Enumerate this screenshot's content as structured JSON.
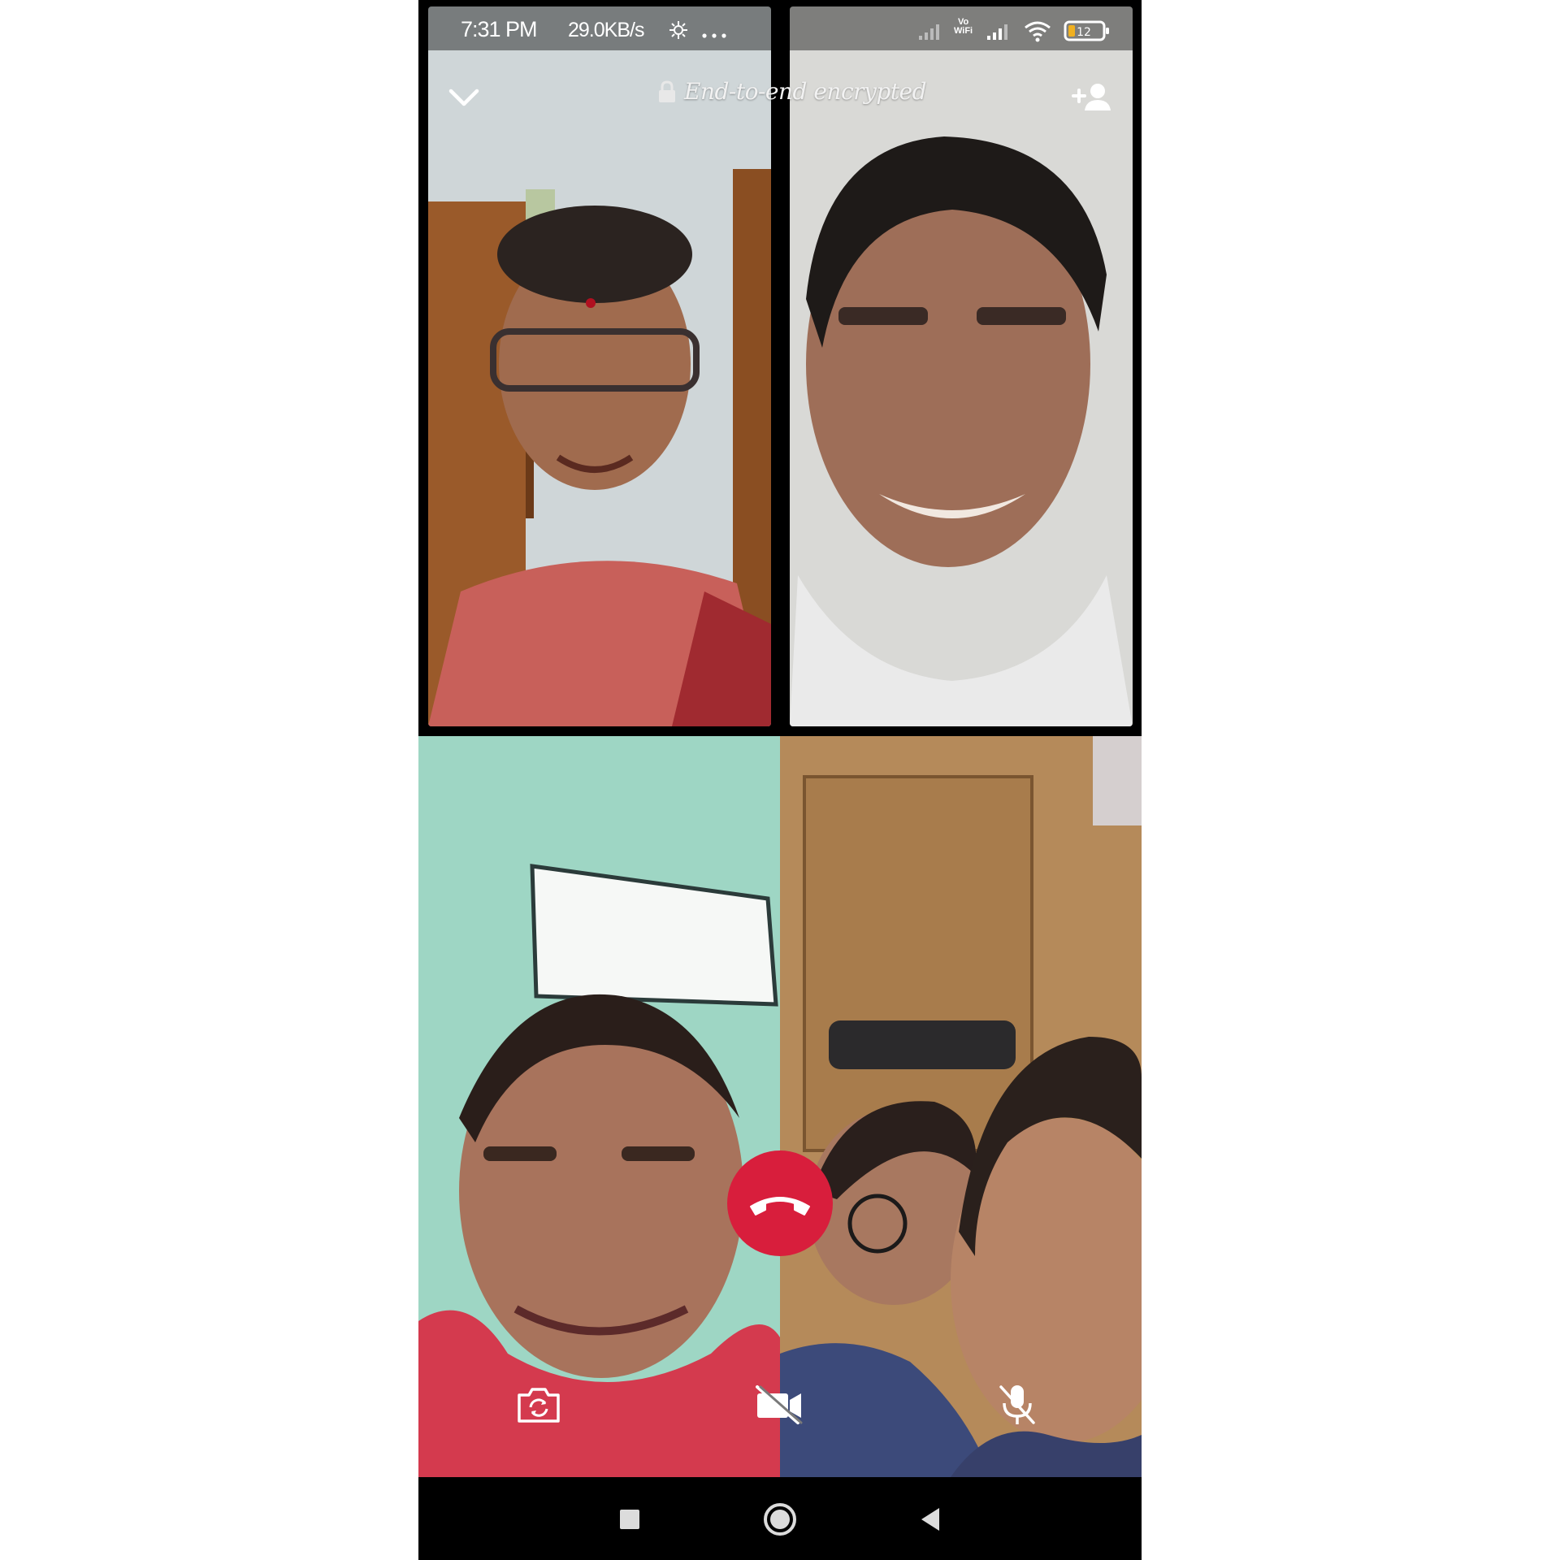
{
  "status_bar": {
    "time": "7:31 PM",
    "network_speed": "29.0KB/s",
    "battery_level": "12",
    "icons": [
      "data-saver-icon",
      "more-notifications-icon",
      "signal-icon",
      "vowifi-icon",
      "signal-icon",
      "wifi-icon",
      "battery-icon"
    ],
    "vowifi_label": "Vo WiFi"
  },
  "call": {
    "encryption_label": "End-to-end encrypted",
    "participants_count": 4,
    "end_call_color": "#d81e3c"
  },
  "controls": {
    "icons": [
      "chevron-down-icon",
      "lock-icon",
      "add-person-icon",
      "end-call-icon",
      "flip-camera-icon",
      "video-off-icon",
      "mic-off-icon"
    ]
  },
  "nav_bar": {
    "icons": [
      "recents-square-icon",
      "home-circle-icon",
      "back-triangle-icon"
    ]
  }
}
